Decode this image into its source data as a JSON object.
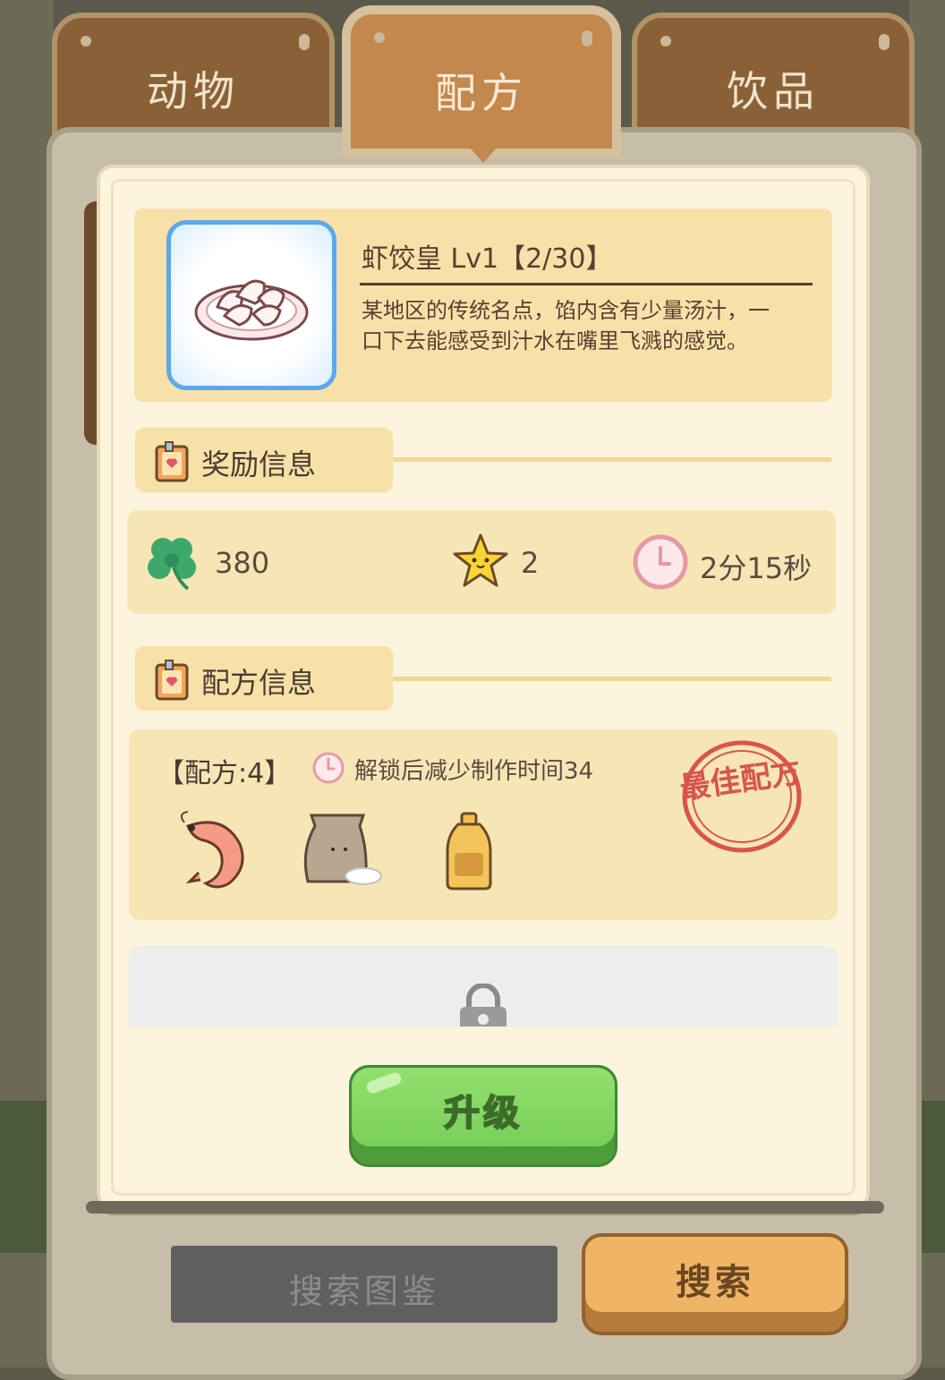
{
  "tabs": [
    {
      "label": "动物",
      "active": false
    },
    {
      "label": "配方",
      "active": true
    },
    {
      "label": "饮品",
      "active": false
    }
  ],
  "item": {
    "name": "虾饺皇 Lv1【2/30】",
    "description": "某地区的传统名点，馅内含有少量汤汁，一口下去能感受到汁水在嘴里飞溅的感觉。",
    "image": "shrimp-dumplings-plate"
  },
  "rewards_section": {
    "title": "奖励信息"
  },
  "rewards": {
    "clover": {
      "value": "380",
      "icon": "clover-icon"
    },
    "star": {
      "value": "2",
      "icon": "star-icon"
    },
    "time": {
      "value": "2分15秒",
      "icon": "clock-icon"
    }
  },
  "recipe_section": {
    "title": "配方信息"
  },
  "recipe": {
    "count_label": "【配方:4】",
    "hint": "解锁后减少制作时间34",
    "stamp": "最佳配方",
    "ingredients": [
      "shrimp",
      "flour-bag",
      "oil-bottle"
    ]
  },
  "upgrade_label": "升级",
  "search_atlas_label": "搜索图鉴",
  "search_label": "搜索",
  "colors": {
    "tab_brown": "#8a6136",
    "tab_active": "#c3884d",
    "panel_bg": "#fdf4de",
    "card_bg": "#f7e1a9",
    "upgrade_green": "#78d05a",
    "search_orange": "#f0b467",
    "stamp_red": "#d9534f"
  }
}
